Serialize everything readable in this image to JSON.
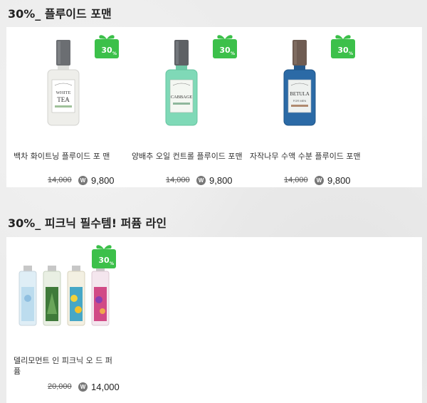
{
  "sections": [
    {
      "title": "30%_ 플루이드 포맨",
      "products": [
        {
          "name": "백차 화이트닝 플루이드 포 맨",
          "old_price": "14,000",
          "currency_icon": "W",
          "new_price": "9,800",
          "badge": "30%"
        },
        {
          "name": "양배추 오일 컨트롤 플루이드 포맨",
          "old_price": "14,000",
          "currency_icon": "W",
          "new_price": "9,800",
          "badge": "30%"
        },
        {
          "name": "자작나무 수액 수분 플루이드 포맨",
          "old_price": "14,000",
          "currency_icon": "W",
          "new_price": "9,800",
          "badge": "30%"
        }
      ]
    },
    {
      "title": "30%_ 피크닉 필수템! 퍼퓸 라인",
      "products": [
        {
          "name": "델리모먼트 인 피크닉 오 드 퍼퓸",
          "old_price": "20,000",
          "currency_icon": "W",
          "new_price": "14,000",
          "badge": "30%"
        }
      ]
    }
  ],
  "bottle_labels": {
    "white_tea": [
      "WHITE",
      "TEA"
    ],
    "cabbage": "CABBAGE",
    "betula": [
      "BETULA",
      "FOR MEN"
    ]
  },
  "colors": {
    "badge_green": "#3cc04a",
    "white_tea_body": "#eeeeea",
    "cabbage_body": "#7fd9b7",
    "betula_body": "#2b6aa6"
  }
}
